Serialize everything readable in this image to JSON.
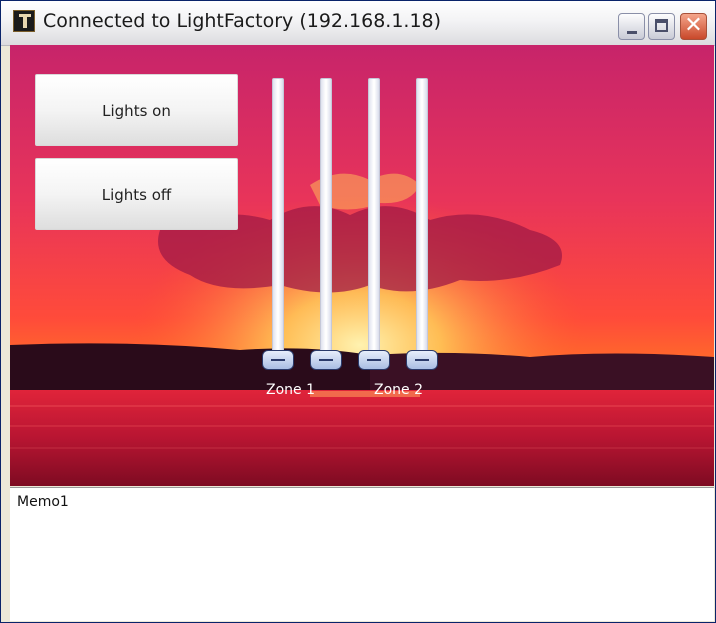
{
  "window": {
    "title": "Connected to LightFactory (192.168.1.18)",
    "controls": {
      "minimize": "minimize-icon",
      "maximize": "maximize-icon",
      "close": "close-icon",
      "close_glyph": "✕"
    }
  },
  "buttons": {
    "lights_on": "Lights on",
    "lights_off": "Lights off"
  },
  "sliders": [
    {
      "zone": "Zone 1",
      "level": 0
    },
    {
      "zone": "Zone 1",
      "level": 0
    },
    {
      "zone": "Zone 2",
      "level": 0
    },
    {
      "zone": "Zone 2",
      "level": 0
    }
  ],
  "zones": {
    "zone1_label": "Zone 1",
    "zone2_label": "Zone 2"
  },
  "memo": {
    "text": "Memo1"
  },
  "colors": {
    "sky_top": "#d62d6a",
    "sky_horizon": "#ff4a2a",
    "sun": "#ffd26a",
    "water": "#b8102a",
    "slider_thumb": "#a9bde3"
  }
}
